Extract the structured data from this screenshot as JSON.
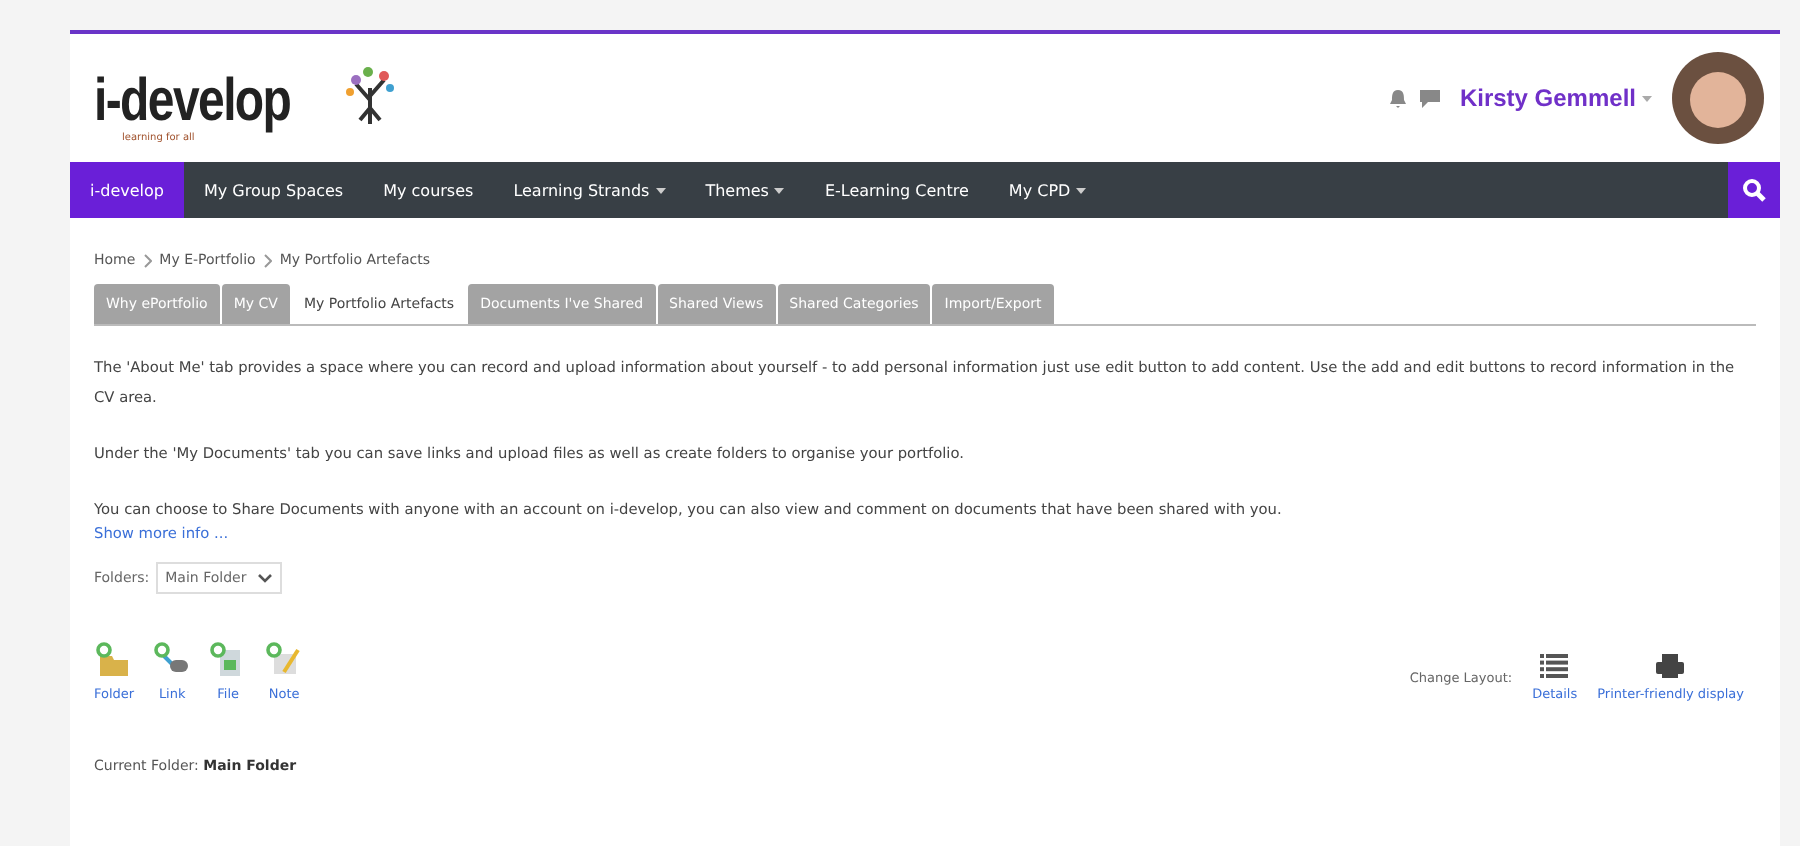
{
  "logo": {
    "name": "i-develop",
    "tagline": "learning for all"
  },
  "user": {
    "name": "Kirsty Gemmell"
  },
  "nav": {
    "items": [
      {
        "label": "i-develop",
        "selected": true,
        "dropdown": false
      },
      {
        "label": "My Group Spaces",
        "selected": false,
        "dropdown": false
      },
      {
        "label": "My courses",
        "selected": false,
        "dropdown": false
      },
      {
        "label": "Learning Strands",
        "selected": false,
        "dropdown": true
      },
      {
        "label": "Themes",
        "selected": false,
        "dropdown": true
      },
      {
        "label": "E-Learning Centre",
        "selected": false,
        "dropdown": false
      },
      {
        "label": "My CPD",
        "selected": false,
        "dropdown": true
      }
    ]
  },
  "breadcrumb": [
    "Home",
    "My E-Portfolio",
    "My Portfolio Artefacts"
  ],
  "tabs": [
    {
      "label": "Why ePortfolio",
      "selected": false
    },
    {
      "label": "My CV",
      "selected": false
    },
    {
      "label": "My Portfolio Artefacts",
      "selected": true
    },
    {
      "label": "Documents I've Shared",
      "selected": false
    },
    {
      "label": "Shared Views",
      "selected": false
    },
    {
      "label": "Shared Categories",
      "selected": false
    },
    {
      "label": "Import/Export",
      "selected": false
    }
  ],
  "paragraphs": [
    "The 'About Me' tab provides a space where you can record and upload information about yourself - to add personal information just use edit button to add content. Use the add and edit buttons to record information in the CV area.",
    "Under the 'My Documents' tab you can save links and upload files as well as create folders to organise your portfolio.",
    "You can choose to Share Documents with anyone with an account on i-develop, you can also view and comment on documents that have been shared with you."
  ],
  "show_more": "Show more info ...",
  "folders": {
    "label": "Folders:",
    "value": "Main Folder"
  },
  "add_actions": [
    {
      "kind": "folder",
      "label": "Folder"
    },
    {
      "kind": "link",
      "label": "Link"
    },
    {
      "kind": "file",
      "label": "File"
    },
    {
      "kind": "note",
      "label": "Note"
    }
  ],
  "layout": {
    "label": "Change Layout:",
    "options": [
      {
        "kind": "details",
        "label": "Details"
      },
      {
        "kind": "print",
        "label": "Printer-friendly display"
      }
    ]
  },
  "current_folder": {
    "label": "Current Folder:",
    "value": "Main Folder"
  }
}
